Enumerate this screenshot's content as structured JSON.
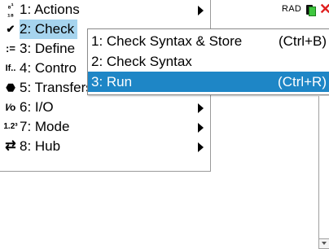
{
  "status": {
    "mode": "RAD"
  },
  "menu": {
    "items": [
      {
        "num_label": "1: Actions",
        "icon": "abc-icon",
        "glyph": "⁸¹₁₈",
        "has_submenu": true
      },
      {
        "num_label": "2: Check",
        "icon": "check-syntax-icon",
        "glyph": "✓",
        "has_submenu": true,
        "selected": true
      },
      {
        "num_label": "3: Define",
        "icon": "define-icon",
        "glyph": ":=",
        "has_submenu": true
      },
      {
        "num_label": "4: Contro",
        "icon": "control-icon",
        "glyph": "If",
        "has_submenu": true
      },
      {
        "num_label": "5: Transfers",
        "icon": "stop-icon",
        "glyph": "●",
        "has_submenu": true
      },
      {
        "num_label": "6: I/O",
        "icon": "io-icon",
        "glyph": "I/O",
        "has_submenu": true
      },
      {
        "num_label": "7: Mode",
        "icon": "mode-icon",
        "glyph": "1.2",
        "has_submenu": true
      },
      {
        "num_label": "8: Hub",
        "icon": "hub-icon",
        "glyph": "⇄",
        "has_submenu": true
      }
    ]
  },
  "submenu": {
    "items": [
      {
        "label": "1: Check Syntax & Store",
        "shortcut": "(Ctrl+B)"
      },
      {
        "label": "2: Check Syntax",
        "shortcut": ""
      },
      {
        "label": "3: Run",
        "shortcut": "(Ctrl+R)",
        "highlighted": true
      }
    ]
  },
  "colors": {
    "highlight": "#1e86c6",
    "selected": "#a6d4ee"
  }
}
